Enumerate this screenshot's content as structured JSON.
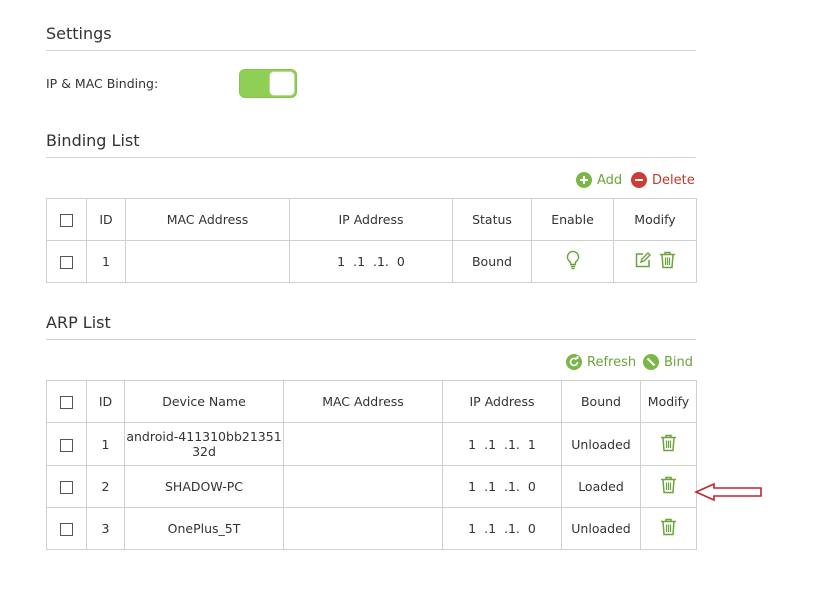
{
  "settings": {
    "title": "Settings",
    "binding_label": "IP & MAC Binding:",
    "binding_enabled": true
  },
  "binding_list": {
    "title": "Binding List",
    "add_label": "Add",
    "delete_label": "Delete",
    "columns": [
      "ID",
      "MAC Address",
      "IP Address",
      "Status",
      "Enable",
      "Modify"
    ],
    "rows": [
      {
        "id": "1",
        "mac": "",
        "ip": "1 .1 .1. 0",
        "status": "Bound"
      }
    ]
  },
  "arp_list": {
    "title": "ARP List",
    "refresh_label": "Refresh",
    "bind_label": "Bind",
    "columns": [
      "ID",
      "Device Name",
      "MAC Address",
      "IP Address",
      "Bound",
      "Modify"
    ],
    "rows": [
      {
        "id": "1",
        "device_line1": "android-411310bb21351",
        "device_line2": "32d",
        "mac": "",
        "ip": "1 .1 .1. 1",
        "bound": "Unloaded"
      },
      {
        "id": "2",
        "device": "SHADOW-PC",
        "mac": "",
        "ip": "1 .1 .1. 0",
        "bound": "Loaded"
      },
      {
        "id": "3",
        "device": "OnePlus_5T",
        "mac": "",
        "ip": "1 .1 .1. 0",
        "bound": "Unloaded"
      }
    ]
  },
  "colors": {
    "accent_green": "#7ab648",
    "toggle_on": "#8fcf55",
    "delete_red": "#d13b35",
    "annotation_arrow": "#c0262b"
  },
  "icons": [
    "add-icon",
    "delete-icon",
    "refresh-icon",
    "bind-icon",
    "bulb-icon",
    "edit-icon",
    "trash-icon",
    "arrow-icon"
  ]
}
